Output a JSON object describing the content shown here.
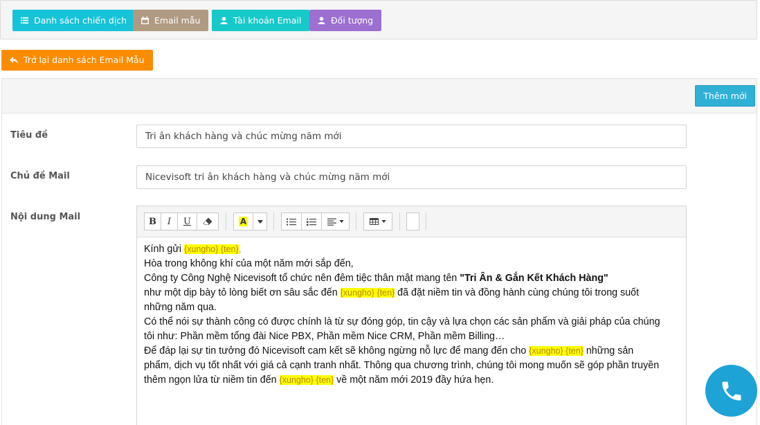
{
  "top_nav": {
    "campaigns_label": "Danh sách chiến dịch",
    "templates_label": "Email mẫu",
    "accounts_label": "Tài khoản Email",
    "audience_label": "Đối tượng",
    "colors": {
      "campaigns": "#17c3d8",
      "templates": "#b09a82",
      "accounts": "#17c9c9",
      "audience": "#9d6fd1"
    }
  },
  "back_button": {
    "label": "Trở lại danh sách Email Mẫu"
  },
  "panel": {
    "add_label": "Thêm mới"
  },
  "form": {
    "title_label": "Tiêu đề",
    "title_value": "Tri ân khách hàng và chúc mừng năm mới",
    "subject_label": "Chủ đề Mail",
    "subject_value": "Nicevisoft tri ân khách hàng và chúc mừng năm mới",
    "content_label": "Nội dung Mail"
  },
  "editor_toolbar": {
    "bold": "B",
    "italic": "I",
    "underline": "U",
    "font_color": "A",
    "icons": [
      "bold-icon",
      "italic-icon",
      "underline-icon",
      "eraser-icon",
      "font-color-icon",
      "unordered-list-icon",
      "ordered-list-icon",
      "align-icon",
      "table-icon"
    ]
  },
  "mail_body": {
    "l1_a": "Kính gửi ",
    "tag_xungho": "{xungho}",
    "tag_ten": "{ten}",
    "l1_b": ",",
    "l2": "Hòa trong không khí của một năm mới sắp đến,",
    "l3_a": "Công ty Công Nghệ Nicevisoft tổ chức nên đêm tiệc thân mật mang tên ",
    "l3_bold": "\"Tri Ân & Gắn Kết Khách Hàng\"",
    "l4_a": "như một dịp bày tỏ lòng biết ơn sâu sắc đến ",
    "l4_b": " đã đặt niềm tin và đồng hành cùng chúng tôi trong suốt",
    "l5": "những năm qua.",
    "l6": "Có thể nói sự thành công có được chính là từ sự đóng góp, tin cậy và lựa chọn các sản phẩm và giải pháp của chúng",
    "l7": "tôi như: Phần mềm tổng đài Nice PBX, Phần mềm Nice CRM, Phần mềm Billing…",
    "l8_a": "Để đáp lại sự tin tưởng đó Nicevisoft cam kết sẽ không ngừng nỗ lực để mang đến cho ",
    "l8_b": " những sản",
    "l9": "phẩm, dịch vụ tốt nhất với giá cả cạnh tranh nhất. Thông qua chương trình, chúng tôi mong muốn sẽ góp phần truyền",
    "l10_a": "thêm ngọn lửa từ niềm tin đến ",
    "l10_b": " về một năm mới 2019 đầy hứa hẹn."
  }
}
